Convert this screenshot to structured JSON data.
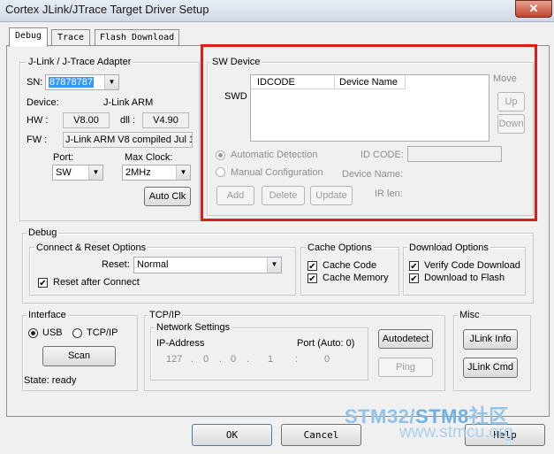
{
  "window": {
    "title": "Cortex JLink/JTrace Target Driver Setup",
    "close_glyph": "✕"
  },
  "tabs": [
    "Debug",
    "Trace",
    "Flash Download"
  ],
  "adapter": {
    "legend": "J-Link / J-Trace Adapter",
    "sn_label": "SN:",
    "sn_value": "87878787",
    "device_label": "Device:",
    "device_value": "J-Link ARM",
    "hw_label": "HW :",
    "hw_value": "V8.00",
    "dll_label": "dll :",
    "dll_value": "V4.90",
    "fw_label": "FW :",
    "fw_value": "J-Link ARM V8 compiled Jul 1",
    "port_label": "Port:",
    "port_value": "SW",
    "clock_label": "Max Clock:",
    "clock_value": "2MHz",
    "auto_clk": "Auto Clk"
  },
  "sw_device": {
    "legend": "SW Device",
    "swd_label": "SWD",
    "col_idcode": "IDCODE",
    "col_device_name": "Device Name",
    "move_label": "Move",
    "up": "Up",
    "down": "Down",
    "auto_detection": "Automatic Detection",
    "manual_config": "Manual Configuration",
    "id_code_label": "ID CODE:",
    "device_name_label": "Device Name:",
    "ir_len_label": "IR len:",
    "add": "Add",
    "delete": "Delete",
    "update": "Update"
  },
  "debug": {
    "legend": "Debug",
    "connect_reset_legend": "Connect & Reset Options",
    "reset_label": "Reset:",
    "reset_value": "Normal",
    "reset_after_connect": "Reset after Connect",
    "cache_legend": "Cache Options",
    "cache_code": "Cache Code",
    "cache_memory": "Cache Memory",
    "download_legend": "Download Options",
    "verify_code": "Verify Code Download",
    "download_flash": "Download to Flash",
    "check_glyph": "✔"
  },
  "interface": {
    "legend": "Interface",
    "usb": "USB",
    "tcpip": "TCP/IP",
    "scan": "Scan",
    "state": "State: ready"
  },
  "tcpip": {
    "legend": "TCP/IP",
    "network_legend": "Network Settings",
    "ip_label": "IP-Address",
    "port_label": "Port (Auto: 0)",
    "ip1": "127",
    "ip2": "0",
    "ip3": "0",
    "ip4": "1",
    "dot": ".",
    "colon": ":",
    "port_value": "0",
    "autodetect": "Autodetect",
    "ping": "Ping"
  },
  "misc": {
    "legend": "Misc",
    "jlink_info": "JLink Info",
    "jlink_cmd": "JLink Cmd"
  },
  "footer": {
    "ok": "OK",
    "cancel": "Cancel",
    "help": "Help"
  },
  "watermark": {
    "line1a": "STM32/",
    "line1b": "STM8",
    "line1c": "社区",
    "line2": "www.stmcu.org"
  },
  "colors": {
    "highlight": "#e01b1b",
    "selection": "#3399ff"
  }
}
